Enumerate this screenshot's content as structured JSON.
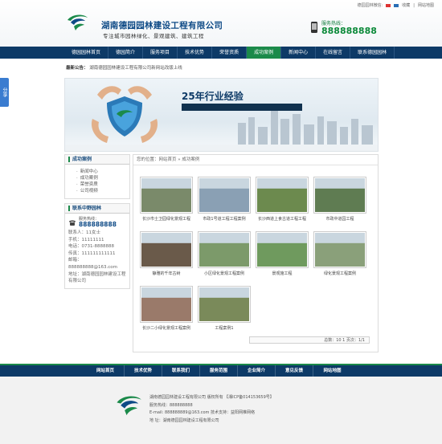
{
  "toplinks": {
    "weixin": "德园园林微信:",
    "collect": "收藏",
    "sitemap": "网站地图"
  },
  "brand": {
    "name": "湖南德园园林建设工程有限公司",
    "tagline": "专注城市园林绿化、景观建筑、建筑工程"
  },
  "hotline": {
    "label": "服务热线：",
    "number": "888888888"
  },
  "nav": [
    "德园园林首页",
    "德园简介",
    "服务项目",
    "技术优势",
    "荣誉资质",
    "成功案例",
    "新闻中心",
    "在线留言",
    "联系德园园林"
  ],
  "nav_active": 5,
  "notice": {
    "label": "最新公告：",
    "text": "湖南德园园林建设工程有限公司新网站改版上线"
  },
  "banner": {
    "title": "25年行业经验"
  },
  "side_share": "分享",
  "sidebar": {
    "cases_title": "成功案例",
    "menu": [
      "新闻中心",
      "成功案例",
      "荣誉资质",
      "公司视频"
    ],
    "contact_title": "联系中野园林",
    "contact": {
      "hot_label": "服务热线：",
      "hot_number": "888888888",
      "person": "联系人：11女士",
      "mobile": "手机：11111111",
      "tel": "电话：0731-8888888",
      "fax": "传真：111111111111",
      "email": "邮箱：888888888@163.com",
      "address": "地址：湖南德园园林建设工程有限公司"
    }
  },
  "main": {
    "breadcrumb": "您的位置：网站首页 » 成功案例",
    "items": [
      {
        "caption": "长沙市士卫园绿化景观工程",
        "color": "#7a8a6a"
      },
      {
        "caption": "市政1号道工程工程案例",
        "color": "#8aa0b4"
      },
      {
        "caption": "长沙西道上食古道工程工程",
        "color": "#6c8a4e"
      },
      {
        "caption": "市政中道园工程",
        "color": "#5f7c52"
      },
      {
        "caption": "静雅的千年古树",
        "color": "#6a5a4a"
      },
      {
        "caption": "小区绿化景观工程案例",
        "color": "#7c9a6a"
      },
      {
        "caption": "景观施工程",
        "color": "#6f9a5e"
      },
      {
        "caption": "绿化景观工程案例",
        "color": "#8aa07a"
      },
      {
        "caption": "长沙二小绿化景观工程案例",
        "color": "#9a7a6a"
      },
      {
        "caption": "工程案例1",
        "color": "#7a8a5a"
      }
    ],
    "pager": "总数：10  1 页次：1/1"
  },
  "footer": {
    "nav": [
      "网站首页",
      "技术优势",
      "联系我们",
      "服务范围",
      "企业简介",
      "意见反馈",
      "网站地图"
    ],
    "line1": "湖南德园园林建设工程有限公司 版权所有 【湘ICP备014153659号】",
    "line2": "服务热线：888888888",
    "line3": "E-mail: 888888889@163.com     技术支持：益阳网推网络",
    "line4": "地 址：湖南德园园林建设工程有限公司"
  },
  "colors": {
    "navy": "#0d3a67",
    "green": "#1b8a4a",
    "brand_blue": "#0e4a86"
  }
}
